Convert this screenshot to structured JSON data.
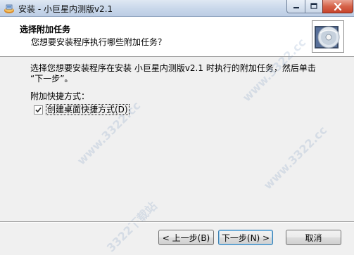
{
  "window": {
    "title": "安装 - 小巨星内测版v2.1"
  },
  "header": {
    "title": "选择附加任务",
    "subtitle": "您想要安装程序执行哪些附加任务？"
  },
  "body": {
    "instruction_line1": "选择您想要安装程序在安装 小巨星内测版v2.1 时执行的附加任务，然后单击",
    "instruction_line2": "“下一步”。",
    "group_label": "附加快捷方式：",
    "checkbox": {
      "label": "创建桌面快捷方式(D)",
      "checked": true
    }
  },
  "footer": {
    "back_label": "< 上一步(B)",
    "next_label": "下一步(N) >",
    "cancel_label": "取消"
  },
  "watermark": {
    "text": "www.3322.cc",
    "text2": "3322下载站"
  },
  "colors": {
    "accent": "#3c7fb1",
    "close_button": "#c7432b",
    "header_bg": "#ffffff",
    "dialog_bg": "#f0f0f0"
  }
}
